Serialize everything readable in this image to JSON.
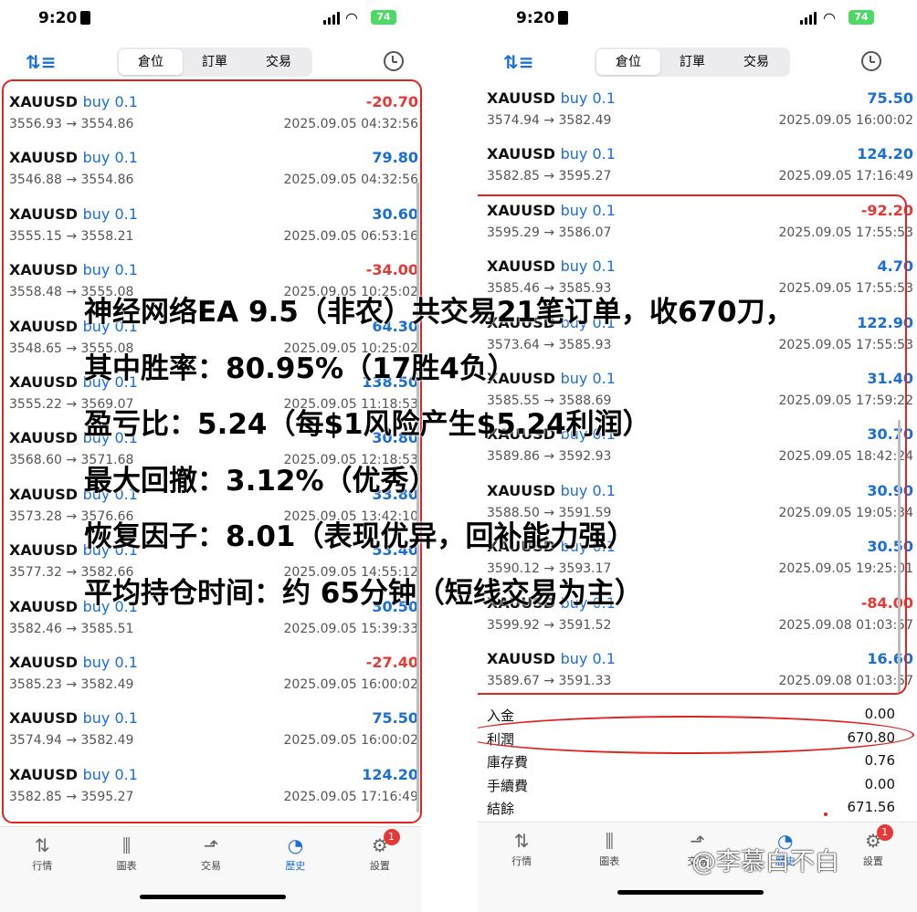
{
  "left": {
    "status": {
      "time": "9:20",
      "battery": "74"
    },
    "tabs": [
      {
        "label": "倉位"
      },
      {
        "label": "訂單"
      },
      {
        "label": "交易"
      }
    ],
    "active_tab": 0,
    "trades": [
      {
        "symbol": "XAUUSD",
        "side": "buy 0.1",
        "pnl": "-20.70",
        "dir": "neg",
        "prices": "3556.93 → 3554.86",
        "time": "2025.09.05 04:32:56"
      },
      {
        "symbol": "XAUUSD",
        "side": "buy 0.1",
        "pnl": "79.80",
        "dir": "pos",
        "prices": "3546.88 → 3554.86",
        "time": "2025.09.05 04:32:56"
      },
      {
        "symbol": "XAUUSD",
        "side": "buy 0.1",
        "pnl": "30.60",
        "dir": "pos",
        "prices": "3555.15 → 3558.21",
        "time": "2025.09.05 06:53:16"
      },
      {
        "symbol": "XAUUSD",
        "side": "buy 0.1",
        "pnl": "-34.00",
        "dir": "neg",
        "prices": "3558.48 → 3555.08",
        "time": "2025.09.05 10:25:02"
      },
      {
        "symbol": "XAUUSD",
        "side": "buy 0.1",
        "pnl": "64.30",
        "dir": "pos",
        "prices": "3548.65 → 3555.08",
        "time": "2025.09.05 10:25:02"
      },
      {
        "symbol": "XAUUSD",
        "side": "buy 0.1",
        "pnl": "138.50",
        "dir": "pos",
        "prices": "3555.22 → 3569.07",
        "time": "2025.09.05 11:18:53"
      },
      {
        "symbol": "XAUUSD",
        "side": "buy 0.1",
        "pnl": "30.80",
        "dir": "pos",
        "prices": "3568.60 → 3571.68",
        "time": "2025.09.05 12:18:53"
      },
      {
        "symbol": "XAUUSD",
        "side": "buy 0.1",
        "pnl": "33.80",
        "dir": "pos",
        "prices": "3573.28 → 3576.66",
        "time": "2025.09.05 13:42:10"
      },
      {
        "symbol": "XAUUSD",
        "side": "buy 0.1",
        "pnl": "53.40",
        "dir": "pos",
        "prices": "3577.32 → 3582.66",
        "time": "2025.09.05 14:55:12"
      },
      {
        "symbol": "XAUUSD",
        "side": "buy 0.1",
        "pnl": "30.50",
        "dir": "pos",
        "prices": "3582.46 → 3585.51",
        "time": "2025.09.05 15:39:33"
      },
      {
        "symbol": "XAUUSD",
        "side": "buy 0.1",
        "pnl": "-27.40",
        "dir": "neg",
        "prices": "3585.23 → 3582.49",
        "time": "2025.09.05 16:00:02"
      },
      {
        "symbol": "XAUUSD",
        "side": "buy 0.1",
        "pnl": "75.50",
        "dir": "pos",
        "prices": "3574.94 → 3582.49",
        "time": "2025.09.05 16:00:02"
      },
      {
        "symbol": "XAUUSD",
        "side": "buy 0.1",
        "pnl": "124.20",
        "dir": "pos",
        "prices": "3582.85 → 3595.27",
        "time": "2025.09.05 17:16:49"
      }
    ],
    "nav": [
      {
        "label": "行情",
        "icon": "⇅"
      },
      {
        "label": "圖表",
        "icon": "⫼"
      },
      {
        "label": "交易",
        "icon": "⬏"
      },
      {
        "label": "歷史",
        "icon": "◔"
      },
      {
        "label": "設置",
        "icon": "⚙",
        "badge": "1"
      }
    ],
    "active_nav": 3
  },
  "right": {
    "status": {
      "time": "9:20",
      "battery": "74"
    },
    "tabs": [
      {
        "label": "倉位"
      },
      {
        "label": "訂單"
      },
      {
        "label": "交易"
      }
    ],
    "active_tab": 0,
    "trades": [
      {
        "symbol": "XAUUSD",
        "side": "buy 0.1",
        "pnl": "75.50",
        "dir": "pos",
        "prices": "3574.94 → 3582.49",
        "time": "2025.09.05 16:00:02"
      },
      {
        "symbol": "XAUUSD",
        "side": "buy 0.1",
        "pnl": "124.20",
        "dir": "pos",
        "prices": "3582.85 → 3595.27",
        "time": "2025.09.05 17:16:49"
      },
      {
        "symbol": "XAUUSD",
        "side": "buy 0.1",
        "pnl": "-92.20",
        "dir": "neg",
        "prices": "3595.29 → 3586.07",
        "time": "2025.09.05 17:55:53"
      },
      {
        "symbol": "XAUUSD",
        "side": "buy 0.1",
        "pnl": "4.70",
        "dir": "pos",
        "prices": "3585.46 → 3585.93",
        "time": "2025.09.05 17:55:53"
      },
      {
        "symbol": "XAUUSD",
        "side": "buy 0.1",
        "pnl": "122.90",
        "dir": "pos",
        "prices": "3573.64 → 3585.93",
        "time": "2025.09.05 17:55:53"
      },
      {
        "symbol": "XAUUSD",
        "side": "buy 0.1",
        "pnl": "31.40",
        "dir": "pos",
        "prices": "3585.55 → 3588.69",
        "time": "2025.09.05 17:59:22"
      },
      {
        "symbol": "XAUUSD",
        "side": "buy 0.1",
        "pnl": "30.70",
        "dir": "pos",
        "prices": "3589.86 → 3592.93",
        "time": "2025.09.05 18:42:24"
      },
      {
        "symbol": "XAUUSD",
        "side": "buy 0.1",
        "pnl": "30.90",
        "dir": "pos",
        "prices": "3588.50 → 3591.59",
        "time": "2025.09.05 19:05:34"
      },
      {
        "symbol": "XAUUSD",
        "side": "buy 0.1",
        "pnl": "30.50",
        "dir": "pos",
        "prices": "3590.12 → 3593.17",
        "time": "2025.09.05 19:25:01"
      },
      {
        "symbol": "XAUUSD",
        "side": "buy 0.1",
        "pnl": "-84.00",
        "dir": "neg",
        "prices": "3599.92 → 3591.52",
        "time": "2025.09.08 01:03:57"
      },
      {
        "symbol": "XAUUSD",
        "side": "buy 0.1",
        "pnl": "16.60",
        "dir": "pos",
        "prices": "3589.67 → 3591.33",
        "time": "2025.09.08 01:03:57"
      }
    ],
    "summary": [
      {
        "label": "入金",
        "value": "0.00"
      },
      {
        "label": "利潤",
        "value": "670.80"
      },
      {
        "label": "庫存費",
        "value": "0.76"
      },
      {
        "label": "手續費",
        "value": "0.00"
      },
      {
        "label": "結餘",
        "value": "671.56"
      }
    ],
    "nav": [
      {
        "label": "行情",
        "icon": "⇅"
      },
      {
        "label": "圖表",
        "icon": "⫼"
      },
      {
        "label": "交易",
        "icon": "⬏"
      },
      {
        "label": "歷史",
        "icon": "◔"
      },
      {
        "label": "設置",
        "icon": "⚙",
        "badge": "1"
      }
    ],
    "active_nav": 3
  },
  "overlay": [
    "神经网络EA 9.5（非农）共交易21笔订单，收670刀，",
    "其中胜率：80.95%（17胜4负）",
    "盈亏比：5.24（每$1风险产生$5.24利润）",
    "最大回撤：3.12%（优秀）",
    "恢复因子：8.01（表现优异，回补能力强）",
    "平均持仓时间：约 65分钟（短线交易为主）"
  ],
  "watermark": "@李慕白不白",
  "colors": {
    "profit": "#1a6fd6",
    "loss": "#e53935",
    "highlight": "#e02424"
  }
}
